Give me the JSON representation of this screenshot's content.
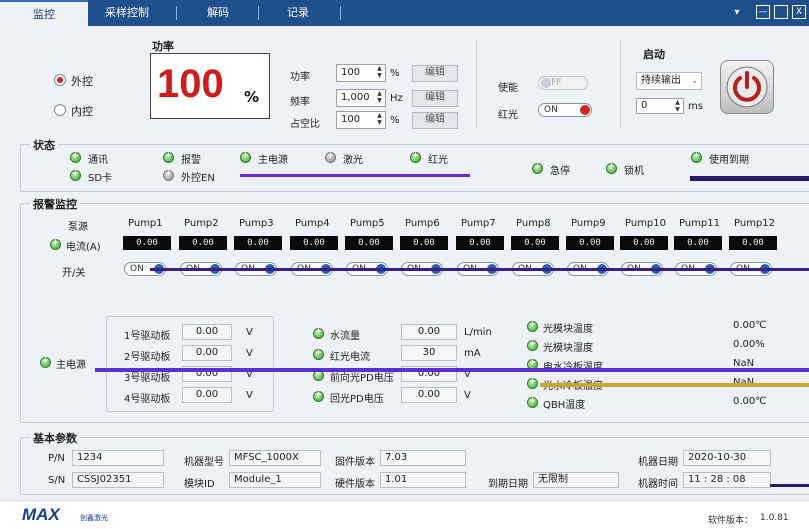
{
  "tabs": [
    "监控",
    "采样控制",
    "解码",
    "记录"
  ],
  "window": {
    "menu_glyph": "▾",
    "minimize": "—",
    "close": "X"
  },
  "power": {
    "heading": "功率",
    "big_value": "100",
    "big_unit": "%",
    "external_label": "外控",
    "internal_label": "内控",
    "rows": [
      {
        "label": "功率",
        "value": "100",
        "unit": "%",
        "btn": "编辑"
      },
      {
        "label": "频率",
        "value": "1,000",
        "unit": "Hz",
        "btn": "编辑"
      },
      {
        "label": "占空比",
        "value": "100",
        "unit": "%",
        "btn": "编辑"
      }
    ],
    "enable_label": "使能",
    "enable_state": "OFF",
    "redlight_label": "红光",
    "redlight_state": "ON"
  },
  "start": {
    "heading": "启动",
    "mode": "持续输出",
    "time_value": "0",
    "time_unit": "ms"
  },
  "status": {
    "title": "状态",
    "row1": [
      {
        "label": "通讯",
        "on": true
      },
      {
        "label": "报警",
        "on": true
      },
      {
        "label": "主电源",
        "on": true
      },
      {
        "label": "激光",
        "on": false
      },
      {
        "label": "红光",
        "on": true
      },
      {
        "label": "使用到期",
        "on": true
      }
    ],
    "row2": [
      {
        "label": "SD卡",
        "on": true
      },
      {
        "label": "外控EN",
        "on": false
      },
      {
        "label": "急停",
        "on": true
      },
      {
        "label": "锁机",
        "on": true
      }
    ]
  },
  "alarm": {
    "title": "报警监控",
    "pump_label": "泵源",
    "current_label": "电流(A)",
    "switch_label": "开/关",
    "pumps": [
      "Pump1",
      "Pump2",
      "Pump3",
      "Pump4",
      "Pump5",
      "Pump6",
      "Pump7",
      "Pump8",
      "Pump9",
      "Pump10",
      "Pump11",
      "Pump12"
    ],
    "currents": [
      "0.00",
      "0.00",
      "0.00",
      "0.00",
      "0.00",
      "0.00",
      "0.00",
      "0.00",
      "0.00",
      "0.00",
      "0.00",
      "0.00"
    ],
    "switch_state": "ON",
    "main_power_label": "主电源",
    "drivers": [
      {
        "label": "1号驱动板",
        "value": "0.00",
        "unit": "V"
      },
      {
        "label": "2号驱动板",
        "value": "0.00",
        "unit": "V"
      },
      {
        "label": "3号驱动板",
        "value": "0.00",
        "unit": "V"
      },
      {
        "label": "4号驱动板",
        "value": "0.00",
        "unit": "V"
      }
    ],
    "sensors": [
      {
        "label": "水流量",
        "value": "0.00",
        "unit": "L/min"
      },
      {
        "label": "红光电流",
        "value": "30",
        "unit": "mA"
      },
      {
        "label": "前向光PD电压",
        "value": "0.00",
        "unit": "V"
      },
      {
        "label": "回光PD电压",
        "value": "0.00",
        "unit": "V"
      }
    ],
    "temps": [
      {
        "label": "光模块温度",
        "value": "0.00℃"
      },
      {
        "label": "光模块湿度",
        "value": "0.00%"
      },
      {
        "label": "电水冷板温度",
        "value": "NaN"
      },
      {
        "label": "光水冷板温度",
        "value": "NaN"
      },
      {
        "label": "QBH温度",
        "value": "0.00℃"
      }
    ]
  },
  "basic": {
    "title": "基本参数",
    "pn_label": "P/N",
    "pn_value": "1234",
    "sn_label": "S/N",
    "sn_value": "CSSJ02351",
    "model_label": "机器型号",
    "model_value": "MFSC_1000X",
    "module_label": "模块ID",
    "module_value": "Module_1",
    "fw_label": "固件版本",
    "fw_value": "7.03",
    "hw_label": "硬件版本",
    "hw_value": "1.01",
    "expire_label": "到期日期",
    "expire_value": "无限制",
    "date_label": "机器日期",
    "date_value": "2020-10-30",
    "time_label": "机器时间",
    "time_value": "11 : 28 : 08"
  },
  "footer": {
    "logo": "MAX",
    "logo_sub": "创鑫激光",
    "version_label": "软件版本：",
    "version_value": "1.0.81"
  },
  "colors": {
    "accent": "#1f4f8c",
    "power_red": "#d21a1a",
    "glitch": "#6a2bd6"
  }
}
